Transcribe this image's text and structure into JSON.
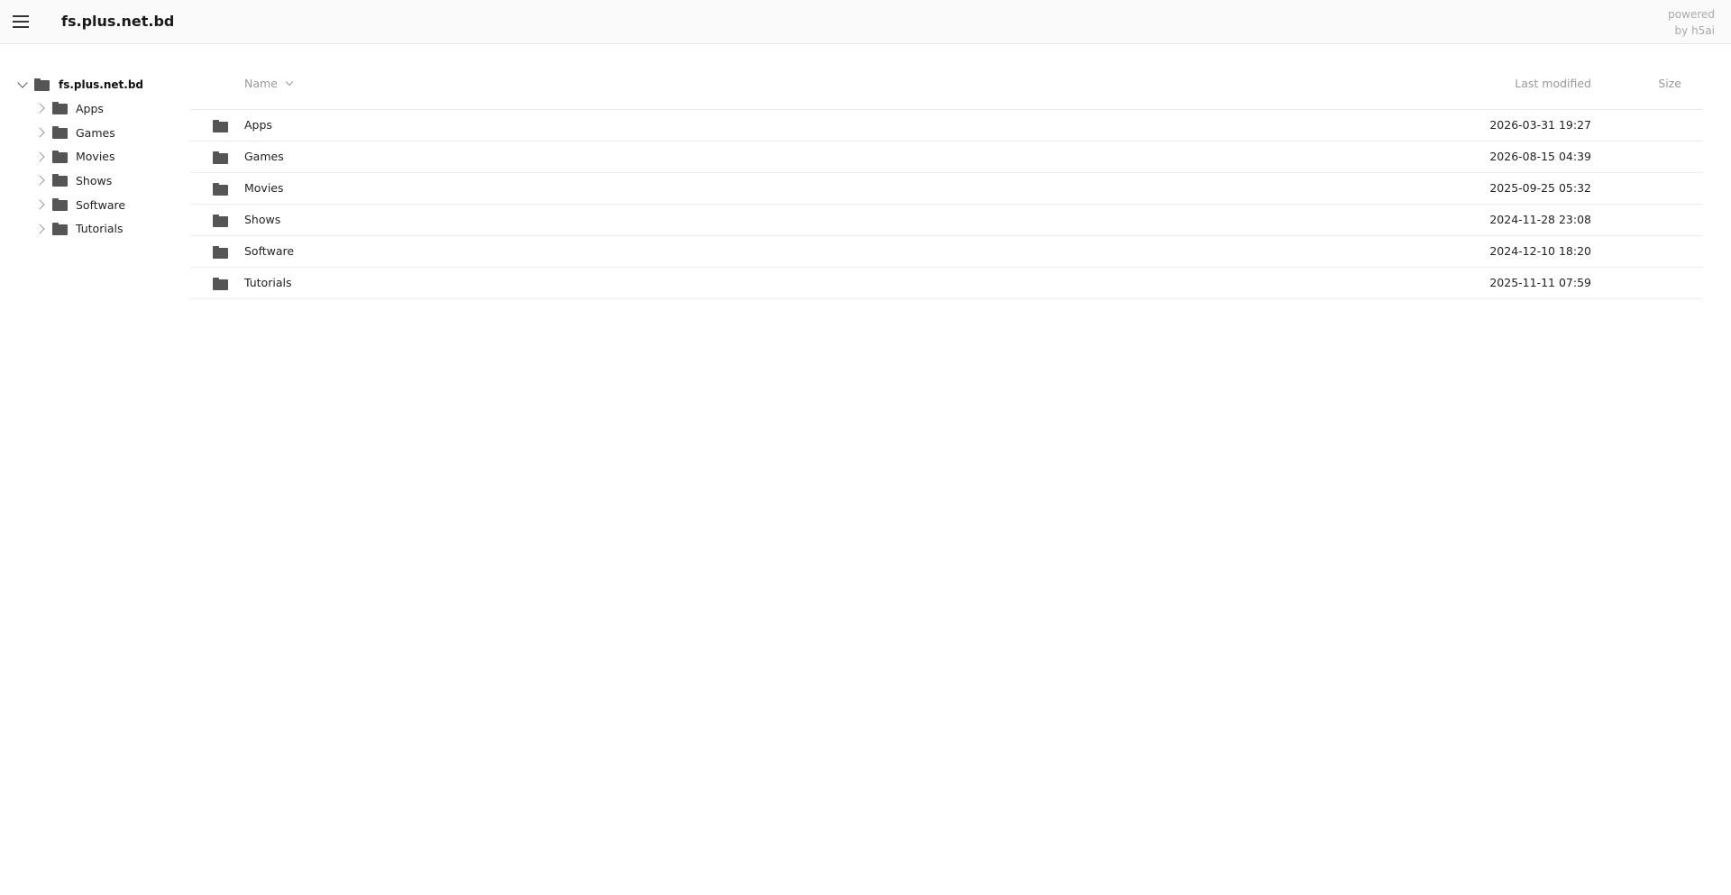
{
  "header": {
    "title": "fs.plus.net.bd",
    "powered_line1": "powered",
    "powered_line2": "by h5ai",
    "menu_icon": "hamburger-menu-icon"
  },
  "tree": {
    "root_label": "fs.plus.net.bd",
    "items": [
      {
        "label": "Apps"
      },
      {
        "label": "Games"
      },
      {
        "label": "Movies"
      },
      {
        "label": "Shows"
      },
      {
        "label": "Software"
      },
      {
        "label": "Tutorials"
      }
    ]
  },
  "list": {
    "headers": {
      "name": "Name",
      "modified": "Last modified",
      "size": "Size"
    },
    "rows": [
      {
        "name": "Apps",
        "modified": "2026-03-31 19:27",
        "size": ""
      },
      {
        "name": "Games",
        "modified": "2026-08-15 04:39",
        "size": ""
      },
      {
        "name": "Movies",
        "modified": "2025-09-25 05:32",
        "size": ""
      },
      {
        "name": "Shows",
        "modified": "2024-11-28 23:08",
        "size": ""
      },
      {
        "name": "Software",
        "modified": "2024-12-10 18:20",
        "size": ""
      },
      {
        "name": "Tutorials",
        "modified": "2025-11-11 07:59",
        "size": ""
      }
    ]
  }
}
